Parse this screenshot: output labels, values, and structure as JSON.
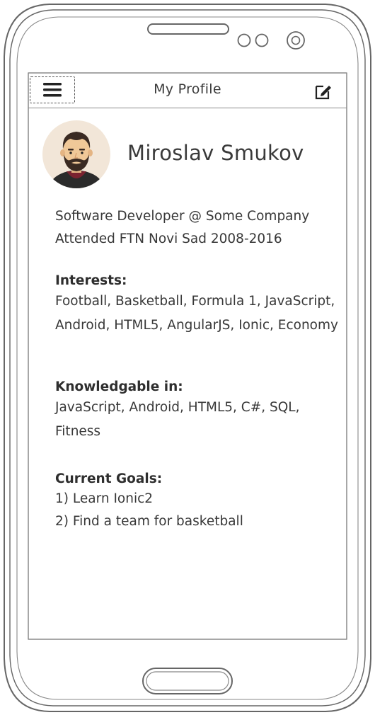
{
  "app_bar": {
    "title": "My Profile",
    "menu_icon": "hamburger-menu-icon",
    "edit_icon": "edit-icon"
  },
  "profile": {
    "avatar_icon": "avatar-man-beard",
    "name": "Miroslav Smukov",
    "job": "Software Developer @ Some Company",
    "education": "Attended FTN Novi Sad 2008-2016"
  },
  "interests": {
    "heading": "Interests:",
    "text": "Football, Basketball, Formula 1, JavaScript, Android, HTML5, AngularJS, Ionic, Economy"
  },
  "knowledgeable": {
    "heading": "Knowledgable in:",
    "text": "JavaScript, Android, HTML5, C#, SQL, Fitness"
  },
  "goals": {
    "heading": "Current Goals:",
    "items": [
      "1) Learn Ionic2",
      "2) Find a team for basketball"
    ]
  },
  "colors": {
    "outline": "#8a8a8a",
    "text": "#383838",
    "avatar_bg": "#f2e6d8",
    "skin": "#f0c898",
    "hair": "#3a2a22",
    "shirt": "#7a2330"
  }
}
